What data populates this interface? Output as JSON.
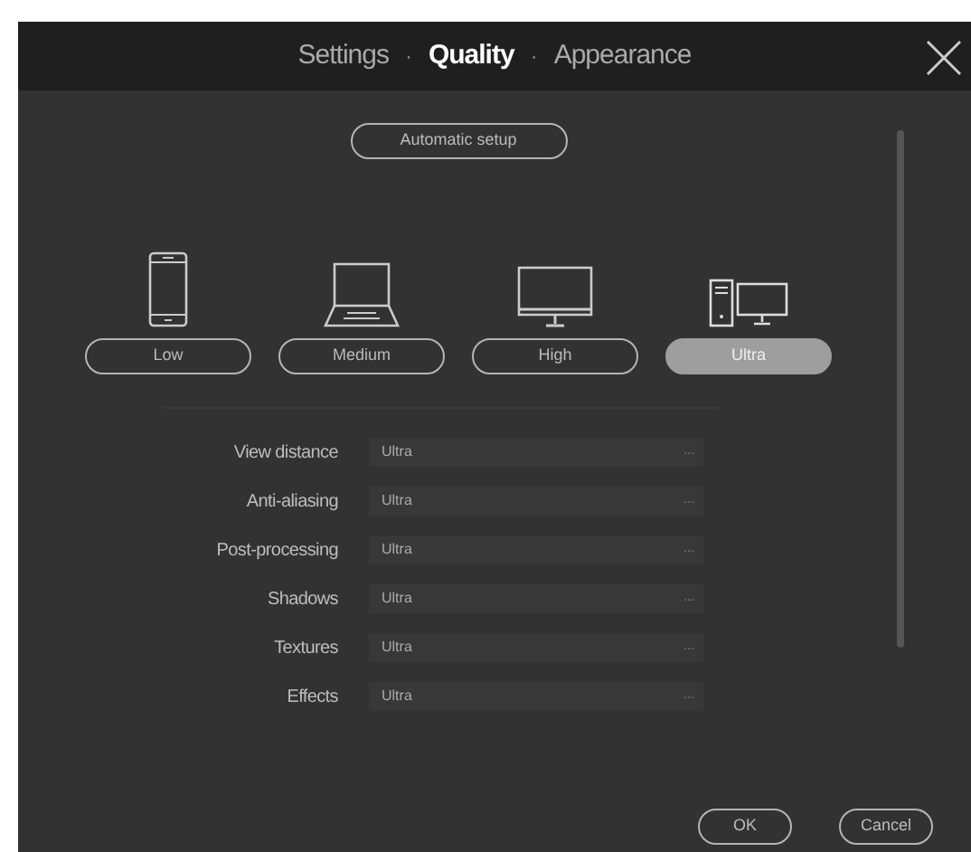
{
  "header": {
    "tabs": [
      {
        "label": "Settings",
        "selected": false
      },
      {
        "label": "Quality",
        "selected": true
      },
      {
        "label": "Appearance",
        "selected": false
      }
    ],
    "separators": [
      "·",
      "·"
    ]
  },
  "auto_button": "Automatic setup",
  "presets": [
    {
      "kind": "phone",
      "label": "Low",
      "selected": false
    },
    {
      "kind": "laptop",
      "label": "Medium",
      "selected": false
    },
    {
      "kind": "monitor",
      "label": "High",
      "selected": false
    },
    {
      "kind": "desktop",
      "label": "Ultra",
      "selected": true
    }
  ],
  "options": [
    {
      "label": "View distance",
      "value": "Ultra",
      "more": "..."
    },
    {
      "label": "Anti-aliasing",
      "value": "Ultra",
      "more": "..."
    },
    {
      "label": "Post-processing",
      "value": "Ultra",
      "more": "..."
    },
    {
      "label": "Shadows",
      "value": "Ultra",
      "more": "..."
    },
    {
      "label": "Textures",
      "value": "Ultra",
      "more": "..."
    },
    {
      "label": "Effects",
      "value": "Ultra",
      "more": "..."
    }
  ],
  "footer_buttons": [
    "OK",
    "Cancel"
  ]
}
